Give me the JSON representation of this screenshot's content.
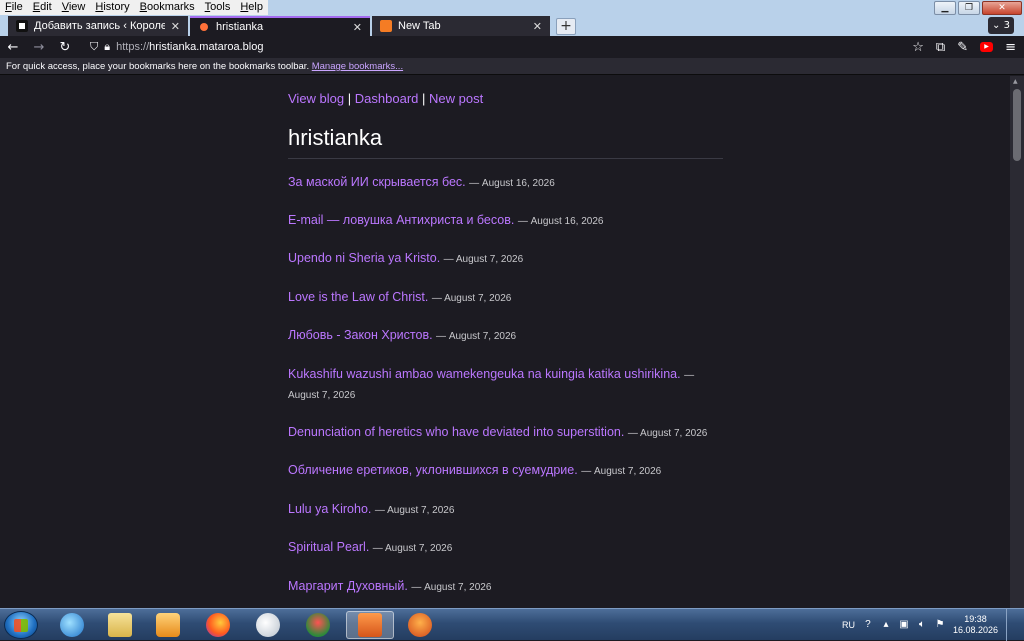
{
  "menu": [
    "File",
    "Edit",
    "View",
    "History",
    "Bookmarks",
    "Tools",
    "Help"
  ],
  "tabs": [
    {
      "label": "Добавить запись ‹ Королевств",
      "active": false
    },
    {
      "label": "hristianka",
      "active": true
    },
    {
      "label": "New Tab",
      "active": false
    }
  ],
  "tab_count": "3",
  "url": {
    "scheme": "https://",
    "host": "hristianka.mataroa.blog"
  },
  "bookmarks_bar": {
    "text": "For quick access, place your bookmarks here on the bookmarks toolbar.",
    "link": "Manage bookmarks..."
  },
  "page": {
    "nav": {
      "view_blog": "View blog",
      "sep": "|",
      "dashboard": "Dashboard",
      "new_post": "New post"
    },
    "title": "hristianka",
    "posts": [
      {
        "title": "За маской ИИ скрывается бес.",
        "date": "— August 16, 2026"
      },
      {
        "title": "E-mail — ловушка Антихриста и бесов.",
        "date": "— August 16, 2026"
      },
      {
        "title": "Upendo ni Sheria ya Kristo.",
        "date": "— August 7, 2026"
      },
      {
        "title": "Love is the Law of Christ.",
        "date": "— August 7, 2026"
      },
      {
        "title": "Любовь - Закон Христов.",
        "date": "— August 7, 2026"
      },
      {
        "title": "Kukashifu wazushi ambao wamekengeuka na kuingia katika ushirikina.",
        "date": "— August 7, 2026"
      },
      {
        "title": "Denunciation of heretics who have deviated into superstition.",
        "date": "— August 7, 2026"
      },
      {
        "title": "Обличение еретиков, уклонившихся в суемудрие.",
        "date": "— August 7, 2026"
      },
      {
        "title": "Lulu ya Kiroho.",
        "date": "— August 7, 2026"
      },
      {
        "title": "Spiritual Pearl.",
        "date": "— August 7, 2026"
      },
      {
        "title": "Маргарит Духовный.",
        "date": "— August 7, 2026"
      }
    ]
  },
  "taskbar": {
    "language": "RU",
    "time": "19:38",
    "date": "16.08.2026"
  },
  "colors": {
    "link": "#bb77ff",
    "background": "#1c1b22",
    "accent": "#a56cf0"
  }
}
